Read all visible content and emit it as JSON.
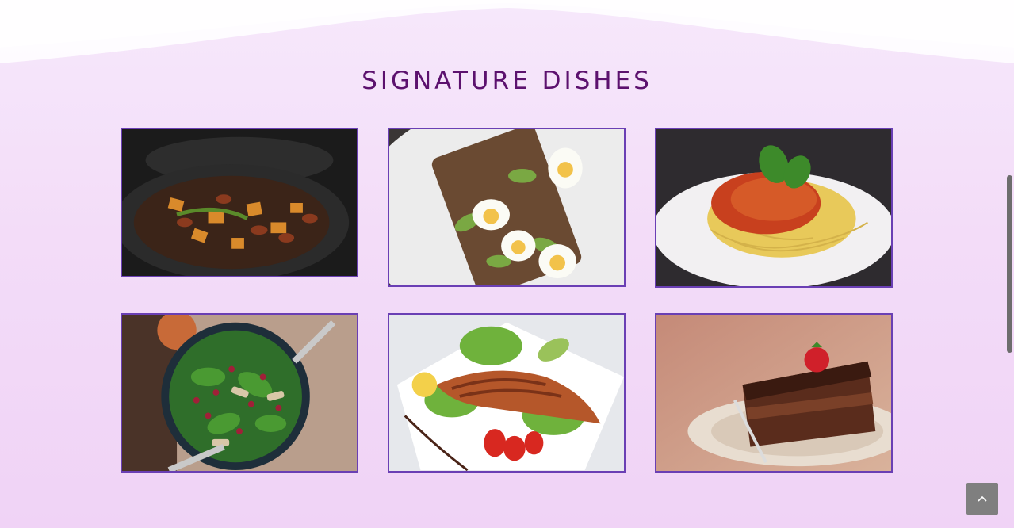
{
  "section": {
    "title": "SIGNATURE DISHES"
  },
  "dishes": [
    {
      "name": "pan-fried-vegetables-image",
      "icon": "food-photo"
    },
    {
      "name": "avocado-egg-toast-image",
      "icon": "food-photo"
    },
    {
      "name": "spaghetti-bolognese-image",
      "icon": "food-photo"
    },
    {
      "name": "spinach-pomegranate-salad-image",
      "icon": "food-photo"
    },
    {
      "name": "grilled-salmon-image",
      "icon": "food-photo"
    },
    {
      "name": "chocolate-cake-image",
      "icon": "food-photo"
    }
  ],
  "back_to_top": {
    "icon": "chevron-up-icon"
  },
  "colors": {
    "title": "#5c116e",
    "card_border": "#6a3fb4",
    "background": "#f3dcf8"
  }
}
